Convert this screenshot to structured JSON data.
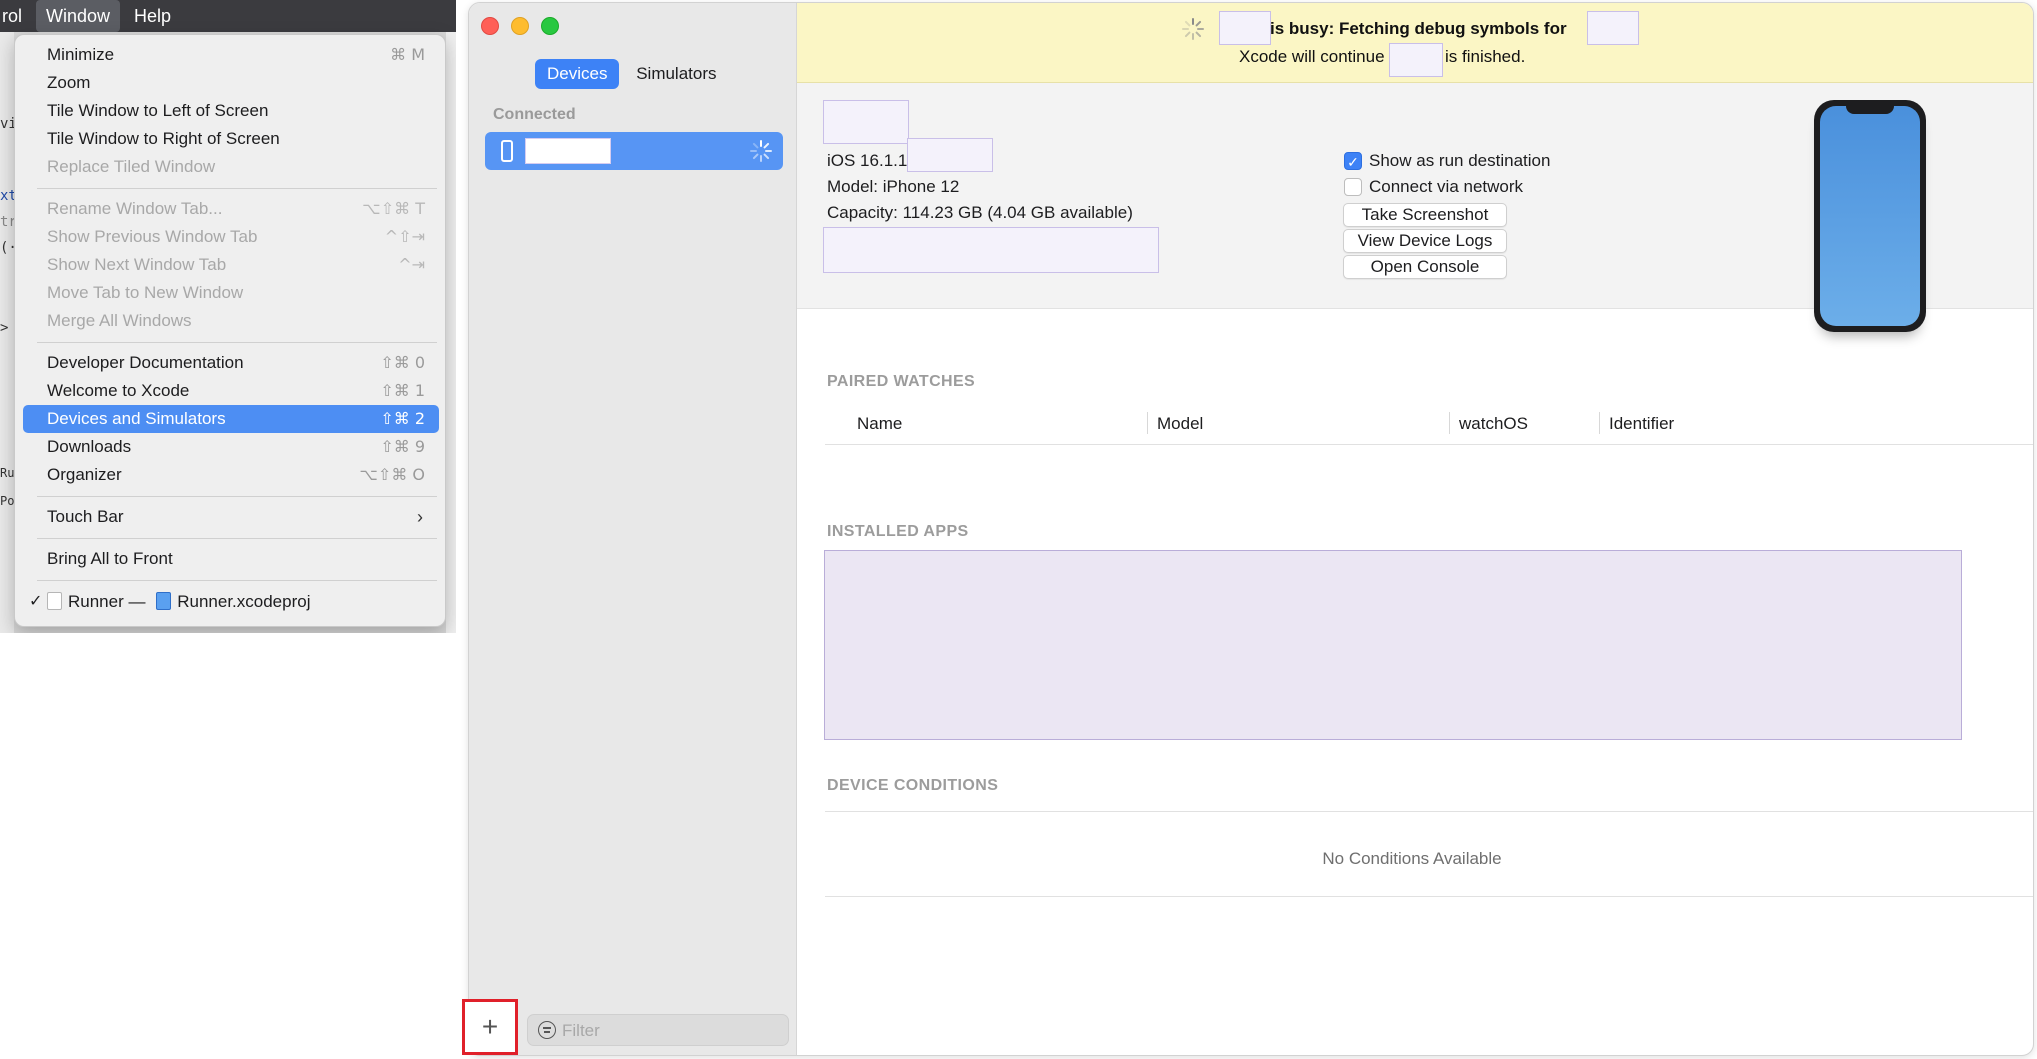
{
  "menubar": {
    "left_fragment": "rol",
    "active": "Window",
    "help": "Help"
  },
  "window_menu": {
    "items": [
      {
        "label": "Minimize",
        "shortcut": "⌘ M",
        "enabled": true
      },
      {
        "label": "Zoom",
        "shortcut": "",
        "enabled": true
      },
      {
        "label": "Tile Window to Left of Screen",
        "shortcut": "",
        "enabled": true
      },
      {
        "label": "Tile Window to Right of Screen",
        "shortcut": "",
        "enabled": true
      },
      {
        "label": "Replace Tiled Window",
        "shortcut": "",
        "enabled": false
      },
      {
        "label": "Rename Window Tab...",
        "shortcut": "⌥⇧⌘ T",
        "enabled": false
      },
      {
        "label": "Show Previous Window Tab",
        "shortcut": "^⇧⇥",
        "enabled": false
      },
      {
        "label": "Show Next Window Tab",
        "shortcut": "^⇥",
        "enabled": false
      },
      {
        "label": "Move Tab to New Window",
        "shortcut": "",
        "enabled": false
      },
      {
        "label": "Merge All Windows",
        "shortcut": "",
        "enabled": false
      },
      {
        "label": "Developer Documentation",
        "shortcut": "⇧⌘ 0",
        "enabled": true
      },
      {
        "label": "Welcome to Xcode",
        "shortcut": "⇧⌘ 1",
        "enabled": true
      },
      {
        "label": "Devices and Simulators",
        "shortcut": "⇧⌘ 2",
        "enabled": true,
        "highlighted": true
      },
      {
        "label": "Downloads",
        "shortcut": "⇧⌘ 9",
        "enabled": true
      },
      {
        "label": "Organizer",
        "shortcut": "⌥⇧⌘ O",
        "enabled": true
      },
      {
        "label": "Touch Bar",
        "shortcut": "",
        "enabled": true,
        "submenu": true
      },
      {
        "label": "Bring All to Front",
        "shortcut": "",
        "enabled": true
      },
      {
        "label": "Runner",
        "shortcut": "",
        "enabled": true,
        "checked": true,
        "project": "Runner.xcodeproj"
      }
    ],
    "runner_dash": "—"
  },
  "background_fragments": [
    "vie",
    "xt",
    "tri",
    "(·",
    ">",
    "Ru",
    "Po"
  ],
  "devices_window": {
    "tabs": [
      "Devices",
      "Simulators"
    ],
    "active_tab": "Devices",
    "connected_header": "Connected",
    "filter_placeholder": "Filter",
    "add_button": "+",
    "banner": {
      "line1": "is busy: Fetching debug symbols for",
      "line2_a": "Xcode will continue when",
      "line2_b": "is finished."
    },
    "device": {
      "ios": "iOS 16.1.1",
      "model": "Model: iPhone 12",
      "capacity": "Capacity: 114.23 GB (4.04 GB available)",
      "show_as_run_destination": {
        "label": "Show as run destination",
        "checked": true
      },
      "connect_via_network": {
        "label": "Connect via network",
        "checked": false
      },
      "buttons": [
        "Take Screenshot",
        "View Device Logs",
        "Open Console"
      ]
    },
    "paired_watches": {
      "title": "PAIRED WATCHES",
      "columns": [
        "Name",
        "Model",
        "watchOS",
        "Identifier"
      ]
    },
    "installed_apps": {
      "title": "INSTALLED APPS"
    },
    "device_conditions": {
      "title": "DEVICE CONDITIONS",
      "empty": "No Conditions Available"
    }
  },
  "colors": {
    "highlight": "#4d8ef3",
    "accent": "#3d82f6",
    "banner": "#fbf6c5",
    "callout": "#e0202a"
  }
}
